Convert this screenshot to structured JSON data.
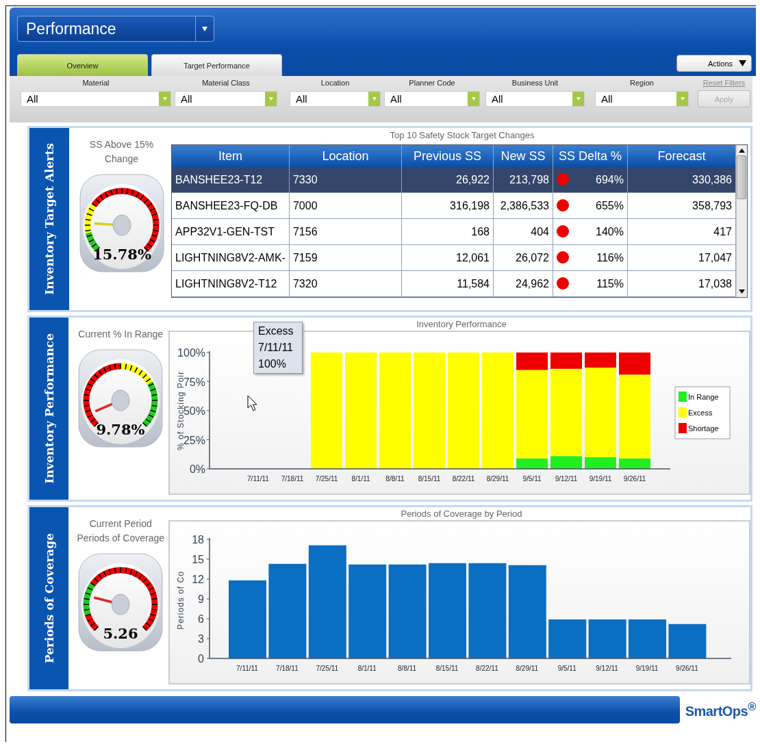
{
  "header": {
    "title": "Performance",
    "tabs": [
      {
        "label": "Overview",
        "selected": true
      },
      {
        "label": "Target Performance",
        "selected": false
      }
    ],
    "actions": "Actions"
  },
  "filters": {
    "fields": [
      {
        "label": "Material",
        "value": "All"
      },
      {
        "label": "Material Class",
        "value": "All"
      },
      {
        "label": "Location",
        "value": "All"
      },
      {
        "label": "Planner Code",
        "value": "All"
      },
      {
        "label": "Business Unit",
        "value": "All"
      },
      {
        "label": "Region",
        "value": "All"
      }
    ],
    "reset": "Reset Filters",
    "apply": {
      "label": "Apply",
      "disabled": true
    }
  },
  "inventory_target_alerts": {
    "title": "Inventory Target Alerts",
    "gauge": {
      "title": "SS Above 15% Change",
      "value": "15.78%"
    },
    "table": {
      "title": "Top 10 Safety Stock Target Changes",
      "columns": [
        "Item",
        "Location",
        "Previous SS",
        "New SS",
        "SS Delta %",
        "Forecast"
      ],
      "rows": [
        {
          "item": "BANSHEE23-T12",
          "location": "7330",
          "previous_ss": "26,922",
          "new_ss": "213,798",
          "color": "#ee0000",
          "delta": "694%",
          "forecast": "330,386",
          "selected": true
        },
        {
          "item": "BANSHEE23-FQ-DB",
          "location": "7000",
          "previous_ss": "316,198",
          "new_ss": "2,386,533",
          "color": "#ee0000",
          "delta": "655%",
          "forecast": "358,793",
          "selected": false
        },
        {
          "item": "APP32V1-GEN-TST",
          "location": "7156",
          "previous_ss": "168",
          "new_ss": "404",
          "color": "#ee0000",
          "delta": "140%",
          "forecast": "417",
          "selected": false
        },
        {
          "item": "LIGHTNING8V2-AMK-",
          "location": "7159",
          "previous_ss": "12,061",
          "new_ss": "26,072",
          "color": "#ee0000",
          "delta": "116%",
          "forecast": "17,047",
          "selected": false
        },
        {
          "item": "LIGHTNING8V2-T12",
          "location": "7320",
          "previous_ss": "11,584",
          "new_ss": "24,962",
          "color": "#ee0000",
          "delta": "115%",
          "forecast": "17,038",
          "selected": false
        }
      ]
    }
  },
  "inventory_performance": {
    "title": "Inventory Performance",
    "gauge": {
      "title": "Current % In Range",
      "value": "9.78%"
    },
    "tooltip": [
      "Excess",
      "7/11/11",
      "100%"
    ],
    "chart_data": {
      "type": "bar",
      "stacked": true,
      "title": "Inventory Performance",
      "ylabel": "% of Stocking Poir",
      "categories": [
        "7/11/11",
        "7/18/11",
        "7/25/11",
        "8/1/11",
        "8/8/11",
        "8/15/11",
        "8/22/11",
        "8/29/11",
        "9/5/11",
        "9/12/11",
        "9/19/11",
        "9/26/11"
      ],
      "series": [
        {
          "name": "In Range",
          "color": "#22ee22",
          "values": [
            0,
            0,
            0,
            0,
            0,
            0,
            0,
            0,
            9,
            11,
            10,
            9
          ]
        },
        {
          "name": "Excess",
          "color": "#ffff00",
          "values": [
            null,
            null,
            100,
            100,
            100,
            100,
            100,
            100,
            76,
            75,
            77,
            72
          ]
        },
        {
          "name": "Shortage",
          "color": "#ee0000",
          "values": [
            0,
            0,
            0,
            0,
            0,
            0,
            0,
            0,
            15,
            14,
            13,
            19
          ]
        }
      ],
      "legend": true,
      "ylim": [
        0,
        100
      ],
      "yticks": [
        {
          "value": 0,
          "label": "0%"
        },
        {
          "value": 25,
          "label": "25%"
        },
        {
          "value": 50,
          "label": "50%"
        },
        {
          "value": 75,
          "label": "75%"
        },
        {
          "value": 100,
          "label": "100%"
        }
      ]
    }
  },
  "periods_of_coverage": {
    "title": "Periods of Coverage",
    "gauge": {
      "title": "Current Period Periods of Coverage",
      "value": "5.26"
    },
    "chart_data": {
      "type": "bar",
      "title": "Periods of Coverage by Period",
      "ylabel": "Periods of Co",
      "categories": [
        "7/11/11",
        "7/18/11",
        "7/25/11",
        "8/1/11",
        "8/8/11",
        "8/15/11",
        "8/22/11",
        "8/29/11",
        "9/5/11",
        "9/12/11",
        "9/19/11",
        "9/26/11"
      ],
      "values": [
        11.8,
        14.3,
        17.1,
        14.2,
        14.2,
        14.4,
        14.4,
        14.1,
        5.9,
        5.9,
        5.9,
        5.2
      ],
      "ylim": [
        0,
        18
      ],
      "yticks": [
        0,
        3,
        6,
        9,
        12,
        15,
        18
      ]
    }
  },
  "footer": {
    "logo": "SmartOps$^{®}$"
  }
}
